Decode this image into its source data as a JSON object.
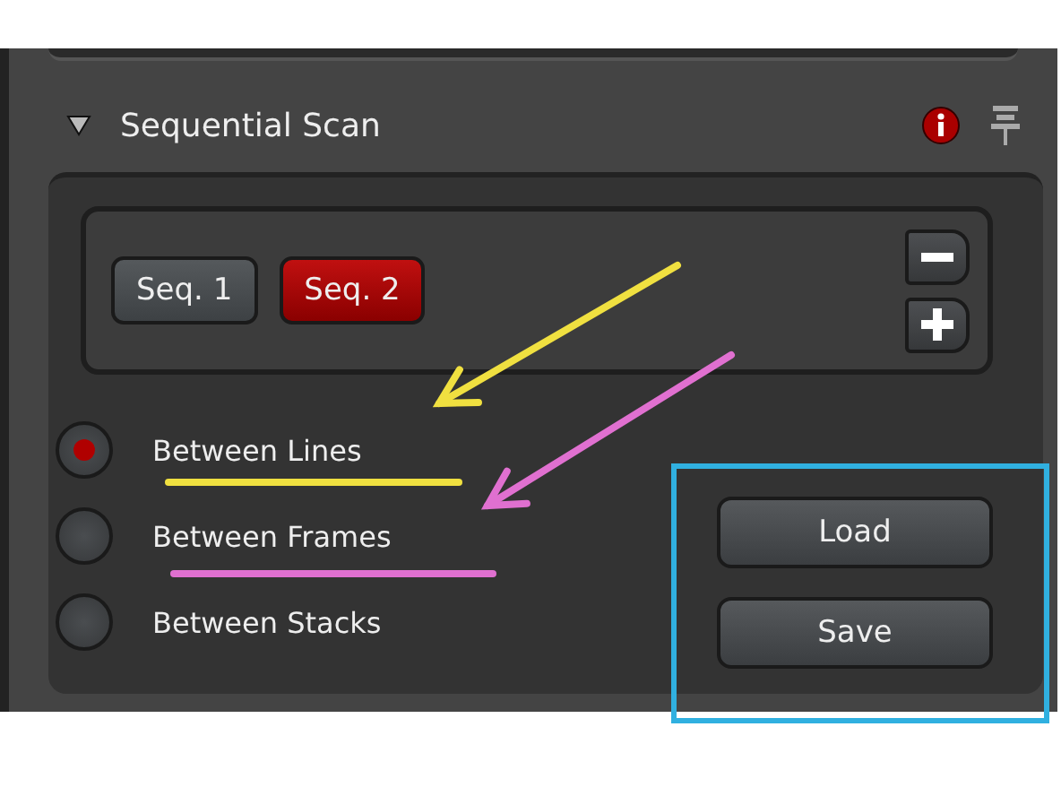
{
  "section": {
    "title": "Sequential Scan",
    "expanded": true
  },
  "sequences": [
    {
      "label": "Seq. 1",
      "selected": false
    },
    {
      "label": "Seq. 2",
      "selected": true
    }
  ],
  "scan_modes": [
    {
      "label": "Between Lines",
      "selected": true
    },
    {
      "label": "Between Frames",
      "selected": false
    },
    {
      "label": "Between Stacks",
      "selected": false
    }
  ],
  "buttons": [
    "Load",
    "Save"
  ],
  "annotations": [
    {
      "kind": "arrow",
      "color": "#f0e040"
    },
    {
      "kind": "underline",
      "color": "#f0e040"
    },
    {
      "kind": "arrow",
      "color": "#e070d0"
    },
    {
      "kind": "underline",
      "color": "#e070d0"
    },
    {
      "kind": "frame",
      "color": "#30b0e0"
    }
  ]
}
